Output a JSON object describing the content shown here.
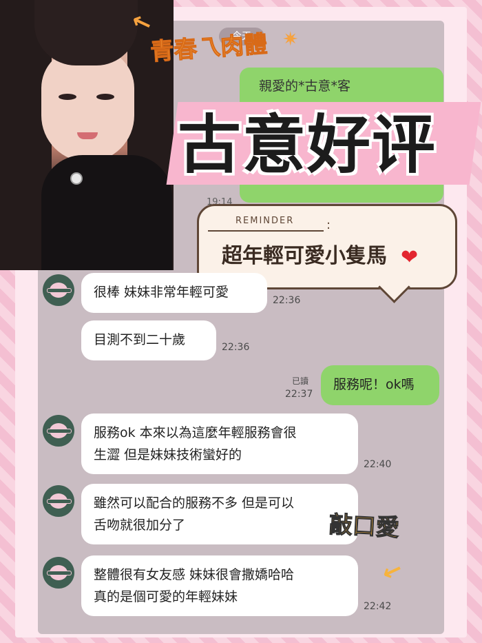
{
  "date_pill": "今天",
  "top_card": {
    "text": "親愛的*古意*客",
    "time": "19:14"
  },
  "sticker": {
    "subtitle": "青春乁肉體",
    "title": "古意好评"
  },
  "reminder": {
    "label": "REMINDER",
    "text": "超年輕可愛小隻馬",
    "heart_icon": "heart-icon"
  },
  "messages": [
    {
      "text": "很棒 妹妹非常年輕可愛",
      "time": "22:36"
    },
    {
      "text": "目測不到二十歲",
      "time": "22:36"
    },
    {
      "text": "服務呢！ok嗎",
      "time": "22:37",
      "read": "已讀"
    },
    {
      "line1": "服務ok 本來以為這麼年輕服務會很",
      "line2": "生澀 但是妹妹技術蠻好的",
      "time": "22:40"
    },
    {
      "line1": "雖然可以配合的服務不多 但是可以",
      "line2": "舌吻就很加分了"
    },
    {
      "line1": "整體很有女友感 妹妹很會撒嬌哈哈",
      "line2": "真的是個可愛的年輕妹妹",
      "time": "22:42"
    }
  ],
  "cute_sticker": "敲口愛",
  "colors": {
    "accent": "#f6a23f",
    "bubble_green": "#8fd46b",
    "frame_pink": "#f7c9d8"
  }
}
